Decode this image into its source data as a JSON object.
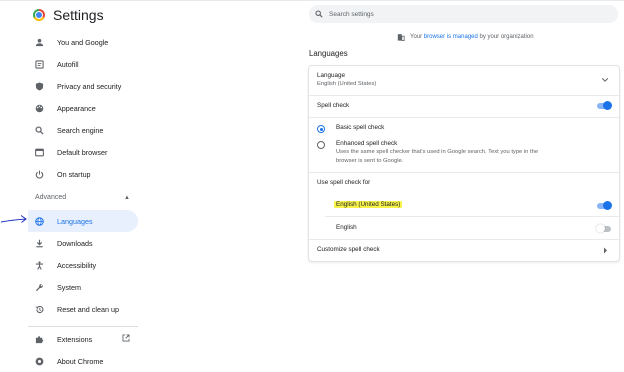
{
  "sidebar": {
    "title": "Settings",
    "items": [
      {
        "label": "You and Google",
        "icon": "person-icon"
      },
      {
        "label": "Autofill",
        "icon": "autofill-icon"
      },
      {
        "label": "Privacy and security",
        "icon": "shield-icon"
      },
      {
        "label": "Appearance",
        "icon": "palette-icon"
      },
      {
        "label": "Search engine",
        "icon": "search-icon"
      },
      {
        "label": "Default browser",
        "icon": "browser-icon"
      },
      {
        "label": "On startup",
        "icon": "power-icon"
      }
    ],
    "advanced_label": "Advanced",
    "advanced_items": [
      {
        "label": "Languages",
        "icon": "globe-icon",
        "active": true
      },
      {
        "label": "Downloads",
        "icon": "download-icon"
      },
      {
        "label": "Accessibility",
        "icon": "accessibility-icon"
      },
      {
        "label": "System",
        "icon": "wrench-icon"
      },
      {
        "label": "Reset and clean up",
        "icon": "history-icon"
      }
    ],
    "extensions_label": "Extensions",
    "about_label": "About Chrome"
  },
  "search": {
    "placeholder": "Search settings"
  },
  "managed": {
    "prefix": "Your",
    "link": "browser is managed",
    "suffix": "by your organization"
  },
  "main": {
    "heading": "Languages",
    "language_label": "Language",
    "language_value": "English (United States)",
    "spell_check_label": "Spell check",
    "spell_check_on": true,
    "basic_label": "Basic spell check",
    "enhanced_label": "Enhanced spell check",
    "enhanced_desc_1": "Uses the same spell checker that's used in Google search. Text you type in the",
    "enhanced_desc_2": "browser is sent to Google.",
    "use_for_label": "Use spell check for",
    "lang1": "English (United States)",
    "lang1_on": true,
    "lang2": "English",
    "lang2_on": false,
    "customize_label": "Customize spell check"
  },
  "colors": {
    "accent": "#1a73e8",
    "highlight": "#f7f34b",
    "active_bg": "#e8f0fe",
    "annotation": "#1a2fbf"
  }
}
